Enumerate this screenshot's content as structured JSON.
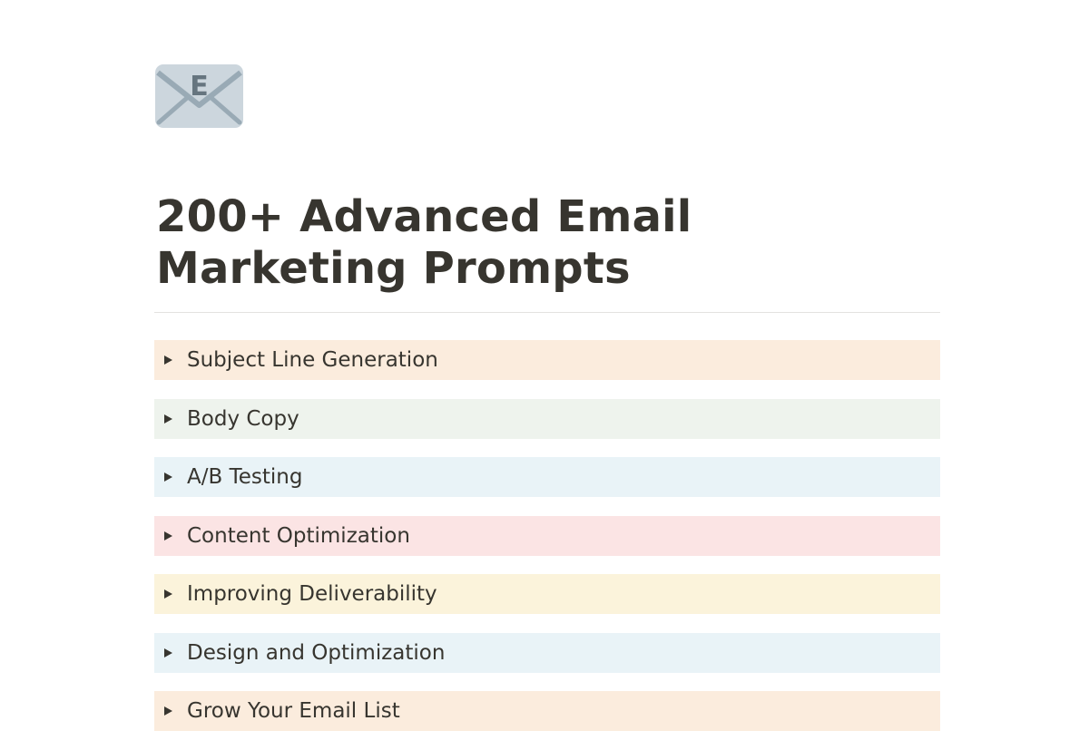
{
  "page": {
    "icon": "envelope-icon",
    "icon_letter": "E",
    "title": "200+ Advanced Email Marketing Prompts"
  },
  "toggles": [
    {
      "label": "Subject Line Generation",
      "color": "#fbecdd"
    },
    {
      "label": "Body Copy",
      "color": "#eef3ed"
    },
    {
      "label": "A/B Testing",
      "color": "#e9f3f7"
    },
    {
      "label": "Content Optimization",
      "color": "#fbe4e4"
    },
    {
      "label": "Improving Deliverability",
      "color": "#fbf3db"
    },
    {
      "label": "Design and Optimization",
      "color": "#e9f3f7"
    },
    {
      "label": "Grow Your Email List",
      "color": "#fbecdd"
    }
  ],
  "icons": {
    "toggle_arrow": "triangle-right-icon"
  }
}
